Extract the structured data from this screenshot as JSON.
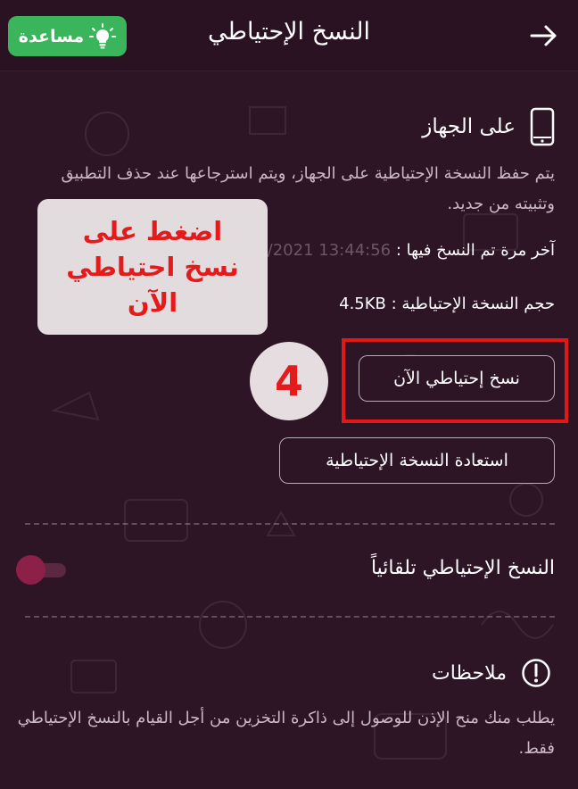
{
  "header": {
    "title": "النسخ الإحتياطي",
    "help_label": "مساعدة"
  },
  "device_section": {
    "title": "على الجهاز",
    "description": "يتم حفظ النسخة الإحتياطية على الجهاز، ويتم استرجاعها عند حذف التطبيق وتثبيته من جديد.",
    "last_backup_label": "آخر مرة تم النسخ فيها :",
    "last_backup_value": "13:44:56 07/04/2021",
    "size_label": "حجم النسخة الإحتياطية :",
    "size_value": "4.5KB",
    "backup_now_label": "نسخ إحتياطي الآن",
    "restore_label": "استعادة النسخة الإحتياطية"
  },
  "annotation": {
    "step_number": "4",
    "callout_lines": [
      "اضغط على",
      "نسخ احتياطي",
      "الآن"
    ],
    "highlight_color": "#e01818"
  },
  "auto_backup": {
    "label": "النسخ الإحتياطي تلقائياً",
    "enabled": false
  },
  "notes": {
    "title": "ملاحظات",
    "description": "يطلب منك منح الإذن للوصول إلى ذاكرة التخزين من أجل القيام بالنسخ الإحتياطي فقط."
  },
  "colors": {
    "background": "#2e1526",
    "help_button": "#3bb55b",
    "toggle_knob": "#8c2046",
    "annotation_red": "#e51b1b"
  },
  "icons": {
    "back": "arrow-right-icon",
    "help": "lightbulb-icon",
    "device": "phone-icon",
    "notes": "info-icon"
  }
}
